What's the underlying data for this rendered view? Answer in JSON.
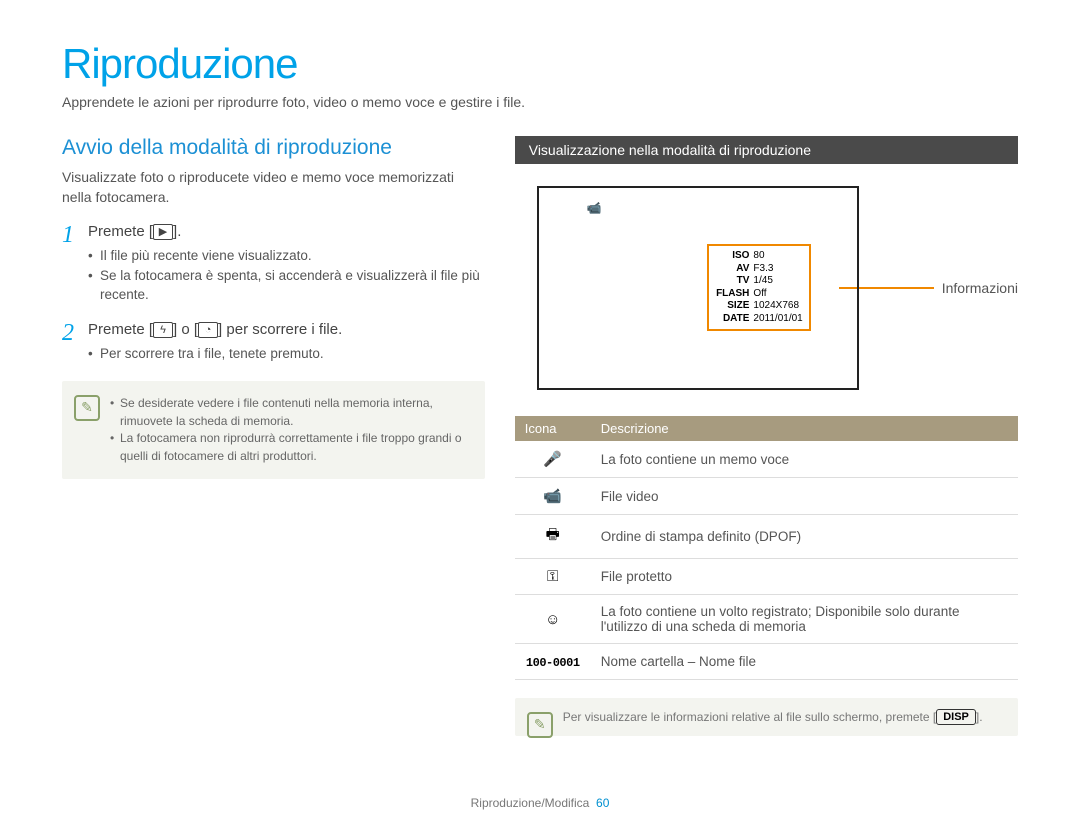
{
  "title": "Riproduzione",
  "lead": "Apprendete le azioni per riprodurre foto, video o memo voce e gestire i file.",
  "left": {
    "h2": "Avvio della modalità di riproduzione",
    "intro": "Visualizzate foto o riproducete video e memo voce memorizzati nella fotocamera.",
    "step1": {
      "num": "1",
      "text_a": "Premete [",
      "text_b": "].",
      "bullet1": "Il file più recente viene visualizzato.",
      "bullet2": "Se la fotocamera è spenta, si accenderà e visualizzerà il file più recente."
    },
    "step2": {
      "num": "2",
      "text_a": "Premete [",
      "text_mid": "] o [",
      "text_b": "] per scorrere i file.",
      "bullet1": "Per scorrere tra i file, tenete premuto."
    },
    "note1": "Se desiderate vedere i file contenuti nella memoria interna, rimuovete la scheda di memoria.",
    "note2": "La fotocamera non riprodurrà correttamente i file troppo grandi o quelli di fotocamere di altri produttori."
  },
  "right": {
    "bar": "Visualizzazione nella modalità di riproduzione",
    "fileNo": "100-0001",
    "info": {
      "ISO": "80",
      "AV": "F3.3",
      "TV": "1/45",
      "FLASH": "Off",
      "SIZE": "1024X768",
      "DATE": "2011/01/01"
    },
    "infoLabel": "Informazioni",
    "table": {
      "h1": "Icona",
      "h2": "Descrizione",
      "r1": "La foto contiene un memo voce",
      "r2": "File video",
      "r3": "Ordine di stampa definito (DPOF)",
      "r4": "File protetto",
      "r5": "La foto contiene un volto registrato; Disponibile solo durante l'utilizzo di una scheda di memoria",
      "r6_icon": "100-0001",
      "r6": "Nome cartella – Nome file"
    },
    "note_a": "Per visualizzare le informazioni relative al file sullo schermo, premete [",
    "note_disp": "DISP",
    "note_b": "]."
  },
  "footer": {
    "section": "Riproduzione/Modifica",
    "page": "60"
  }
}
